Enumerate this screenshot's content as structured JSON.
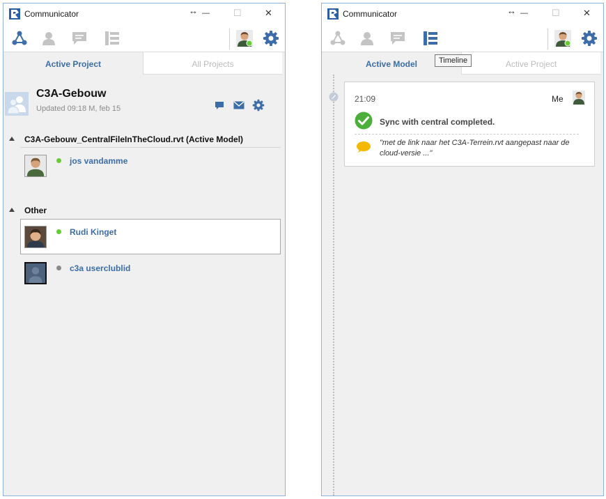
{
  "left_window": {
    "title": "Communicator",
    "controls": {
      "resize": "↔",
      "minimize": "—",
      "maximize": "☐",
      "close": "✕"
    },
    "tabs": [
      {
        "label": "Active Project"
      },
      {
        "label": "All Projects"
      }
    ],
    "project": {
      "name": "C3A-Gebouw",
      "updated": "Updated 09:18 M, feb 15"
    },
    "groups": [
      {
        "title": "C3A-Gebouw_CentralFileInTheCloud.rvt (Active Model)",
        "users": [
          {
            "name": "jos vandamme",
            "status_color": "#66cc33"
          }
        ]
      },
      {
        "title": "Other",
        "users": [
          {
            "name": "Rudi Kinget",
            "status_color": "#66cc33"
          },
          {
            "name": "c3a userclublid",
            "status_color": "#8a8a8a"
          }
        ]
      }
    ]
  },
  "right_window": {
    "title": "Communicator",
    "controls": {
      "resize": "↔",
      "minimize": "—",
      "maximize": "☐",
      "close": "✕"
    },
    "tabs": [
      {
        "label": "Active Model"
      },
      {
        "label": "Active Project"
      }
    ],
    "tooltip": "Timeline",
    "event": {
      "time": "21:09",
      "author": "Me",
      "status": "Sync with central completed.",
      "comment": "\"met de link naar het C3A-Terrein.rvt aangepast naar de cloud-versie ...\""
    }
  },
  "colors": {
    "accent": "#3c6da8",
    "online": "#66cc33",
    "offline": "#8a8a8a"
  }
}
